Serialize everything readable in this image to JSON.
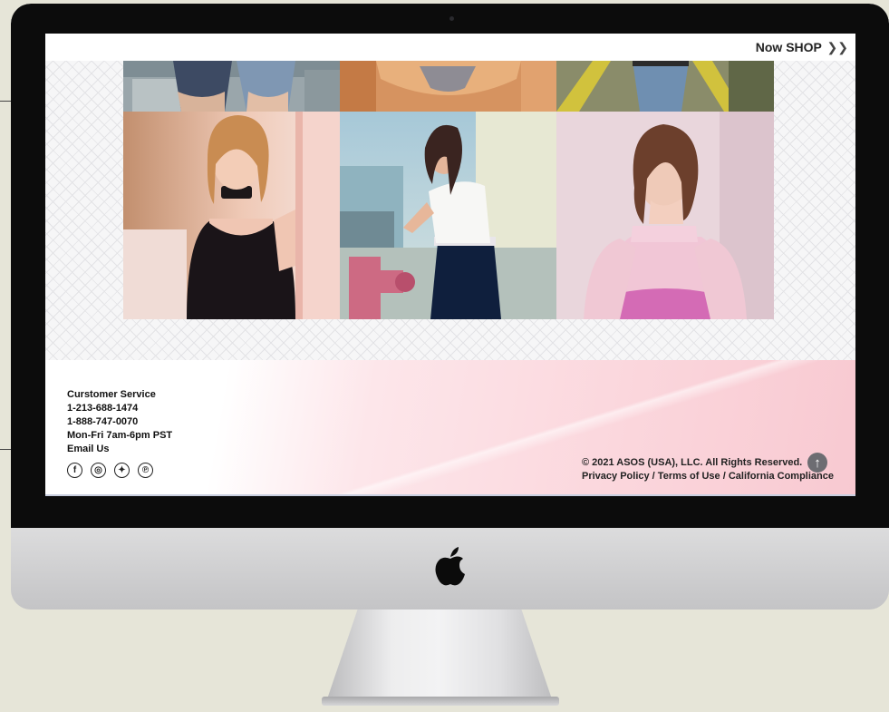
{
  "header": {
    "shop_label": "Now SHOP",
    "shop_chevron": "❯❯"
  },
  "gallery": {
    "photos": [
      {
        "name": "top-left-crop",
        "palette": [
          "#8c9aa1",
          "#b7bfc3"
        ]
      },
      {
        "name": "top-center-crop",
        "palette": [
          "#c98a57",
          "#e8b27d"
        ]
      },
      {
        "name": "top-right-crop",
        "palette": [
          "#7f8a5d",
          "#c9b870"
        ]
      },
      {
        "name": "portrait-choker-blonde",
        "palette": [
          "#f1d7c9",
          "#c3927a"
        ]
      },
      {
        "name": "portrait-rooftop-hydrant",
        "palette": [
          "#9bc1d3",
          "#d8a0b2"
        ]
      },
      {
        "name": "portrait-pink-sleeves",
        "palette": [
          "#e6cfd8",
          "#d689c0"
        ]
      }
    ]
  },
  "footer": {
    "customer_service": {
      "title": "Curstomer Service",
      "phone_1": "1-213-688-1474",
      "phone_2": "1-888-747-0070",
      "hours": "Mon-Fri 7am-6pm PST",
      "email": "Email Us"
    },
    "social": [
      {
        "icon": "facebook-icon",
        "glyph": "f"
      },
      {
        "icon": "instagram-icon",
        "glyph": "◎"
      },
      {
        "icon": "twitter-icon",
        "glyph": "✦"
      },
      {
        "icon": "pinterest-icon",
        "glyph": "℗"
      }
    ],
    "copyright": "© 2021 ASOS (USA), LLC. All Rights Reserved.",
    "links": {
      "privacy": "Privacy Policy",
      "terms": "Terms of Use",
      "california": "California Compliance",
      "separator": "/"
    },
    "scroll_top_icon": "↑"
  },
  "colors": {
    "footer_pink": "#f8c9d1",
    "page_background": "#e6e5d8"
  }
}
